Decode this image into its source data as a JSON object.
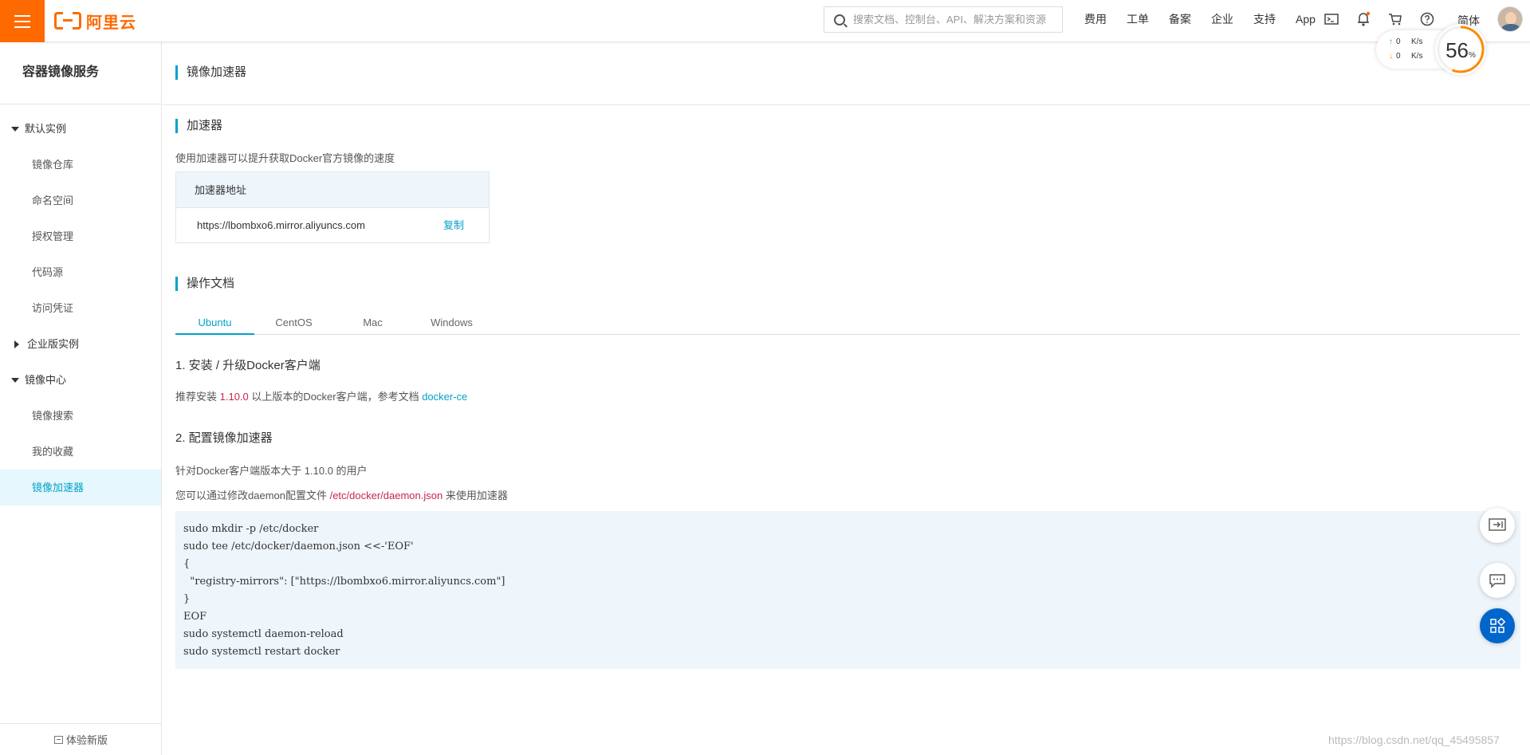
{
  "header": {
    "logo_text": "阿里云",
    "search_placeholder": "搜索文档、控制台、API、解决方案和资源",
    "nav": [
      "费用",
      "工单",
      "备案",
      "企业",
      "支持",
      "App"
    ],
    "lang": "简体",
    "accent": "#ff6a00"
  },
  "speed_widget": {
    "up_value": "0",
    "down_value": "0",
    "unit": "K/s",
    "percent": "56",
    "percent_sign": "%"
  },
  "sidebar": {
    "title": "容器镜像服务",
    "group_default": "默认实例",
    "items_default": [
      "镜像仓库",
      "命名空间",
      "授权管理",
      "代码源",
      "访问凭证"
    ],
    "group_enterprise": "企业版实例",
    "group_center": "镜像中心",
    "items_center": [
      "镜像搜索",
      "我的收藏",
      "镜像加速器"
    ],
    "active_item": "镜像加速器",
    "bottom": "体验新版"
  },
  "main": {
    "page_title": "镜像加速器",
    "accelerator": {
      "title": "加速器",
      "desc": "使用加速器可以提升获取Docker官方镜像的速度",
      "table_header": "加速器地址",
      "address": "https://lbombxo6.mirror.aliyuncs.com",
      "copy_label": "复制"
    },
    "docs": {
      "title": "操作文档",
      "tabs": [
        "Ubuntu",
        "CentOS",
        "Mac",
        "Windows"
      ],
      "active_tab": "Ubuntu",
      "step1_title": "1. 安装 / 升级Docker客户端",
      "step1_pre": "推荐安装 ",
      "step1_version": "1.10.0",
      "step1_mid": " 以上版本的Docker客户端，参考文档 ",
      "step1_link": "docker-ce",
      "step2_title": "2. 配置镜像加速器",
      "step2_line1": "针对Docker客户端版本大于 1.10.0 的用户",
      "step2_line2_pre": "您可以通过修改daemon配置文件 ",
      "step2_line2_path": "/etc/docker/daemon.json",
      "step2_line2_post": " 来使用加速器",
      "code": "sudo mkdir -p /etc/docker\nsudo tee /etc/docker/daemon.json <<-'EOF'\n{\n  \"registry-mirrors\": [\"https://lbombxo6.mirror.aliyuncs.com\"]\n}\nEOF\nsudo systemctl daemon-reload\nsudo systemctl restart docker"
    }
  },
  "watermark": "https://blog.csdn.net/qq_45495857"
}
